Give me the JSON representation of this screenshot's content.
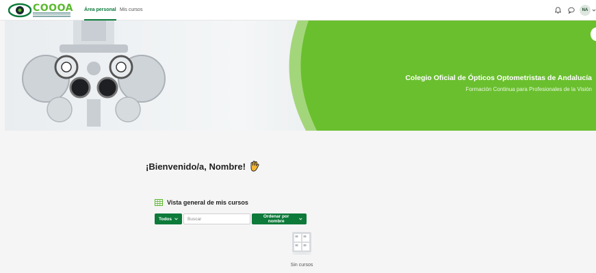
{
  "header": {
    "logo_text": "COOOA",
    "nav": [
      {
        "label": "Área personal",
        "active": true
      },
      {
        "label": "Mis cursos",
        "active": false
      }
    ],
    "user_initials": "NA"
  },
  "hero": {
    "title": "Colegio Oficial de Ópticos Optometristas de Andalucía",
    "subtitle": "Formación Continua para Profesionales de la Visión"
  },
  "main": {
    "welcome": "¡Bienvenido/a, Nombre!",
    "overview": {
      "heading": "Vista general de mis cursos",
      "filter_label": "Todos",
      "search_placeholder": "Buscar",
      "sort_label": "Ordenar por nombre",
      "empty_label": "Sin cursos"
    }
  },
  "colors": {
    "brand_green": "#6abf2e",
    "button_green": "#0d7a3a",
    "nav_active": "#0a7a3a"
  },
  "icons": [
    "logo-eye-icon",
    "bell-icon",
    "chat-icon",
    "chevron-down-icon",
    "waving-hand-icon",
    "grid-icon",
    "empty-courses-icon"
  ]
}
